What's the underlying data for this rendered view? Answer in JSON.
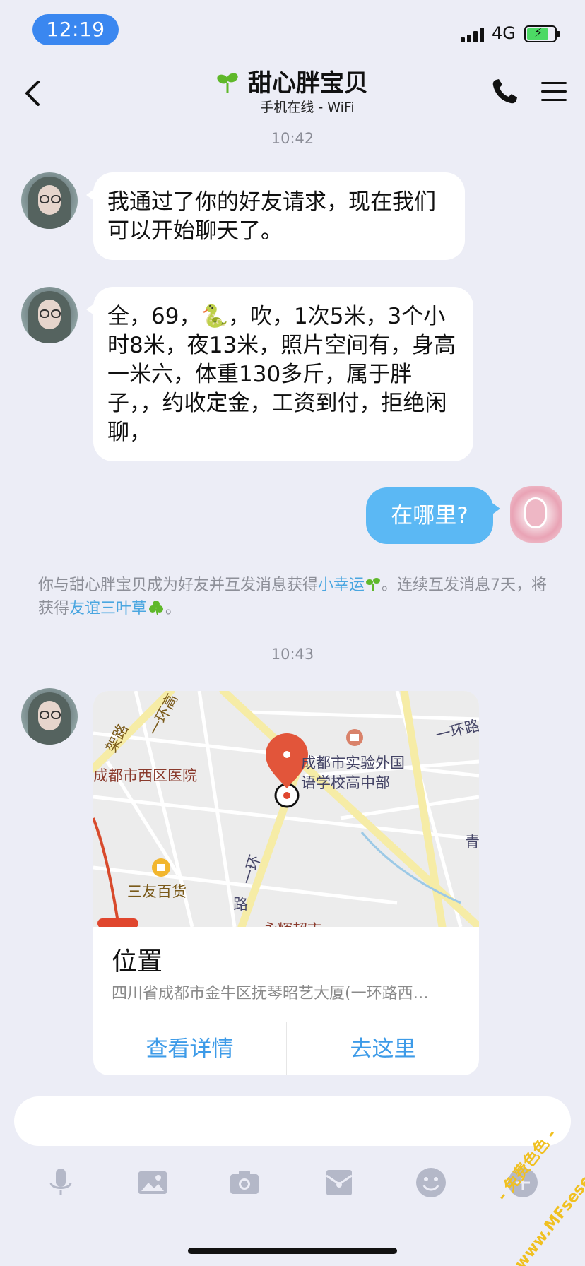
{
  "status_bar": {
    "time": "12:19",
    "network": "4G"
  },
  "header": {
    "title": "甜心胖宝贝",
    "subtitle": "手机在线 - WiFi",
    "accent_color": "#5fb82a"
  },
  "messages": {
    "time1": "10:42",
    "msg1": "我通过了你的好友请求，现在我们可以开始聊天了。",
    "msg2": "全，69，🐍，吹，1次5米，3个小时8米，夜13米，照片空间有，身高一米六，体重130多斤，属于胖子，，约收定金，工资到付，拒绝闲聊，",
    "msg3": "在哪里?",
    "system_a": "你与甜心胖宝贝成为好友并互发消息获得",
    "system_link1": "小幸运",
    "system_b": "。连续互发消息7天，将获得",
    "system_link2": "友谊三叶草",
    "system_c": "。",
    "time2": "10:43"
  },
  "location": {
    "map_labels": {
      "ring_road_top": "一环高",
      "road_jia": "架路",
      "hospital": "成都市西区医院",
      "school_line1": "成都市实验外国",
      "school_line2": "语学校高中部",
      "ring_right": "一环路",
      "qing": "青",
      "store": "三友百货",
      "ring_road_v1": "一环",
      "ring_road_v2": "路",
      "market": "永辉超市"
    },
    "title": "位置",
    "address": "四川省成都市金牛区抚琴昭艺大厦(一环路西…",
    "btn_detail": "查看详情",
    "btn_go": "去这里"
  },
  "input": {
    "value": ""
  },
  "toolbar_icons": [
    "mic-icon",
    "image-icon",
    "camera-icon",
    "gift-icon",
    "emoji-icon",
    "more-icon"
  ],
  "watermark": {
    "line1": "- 免费色色 -",
    "line2": "www.MFsese.com"
  }
}
